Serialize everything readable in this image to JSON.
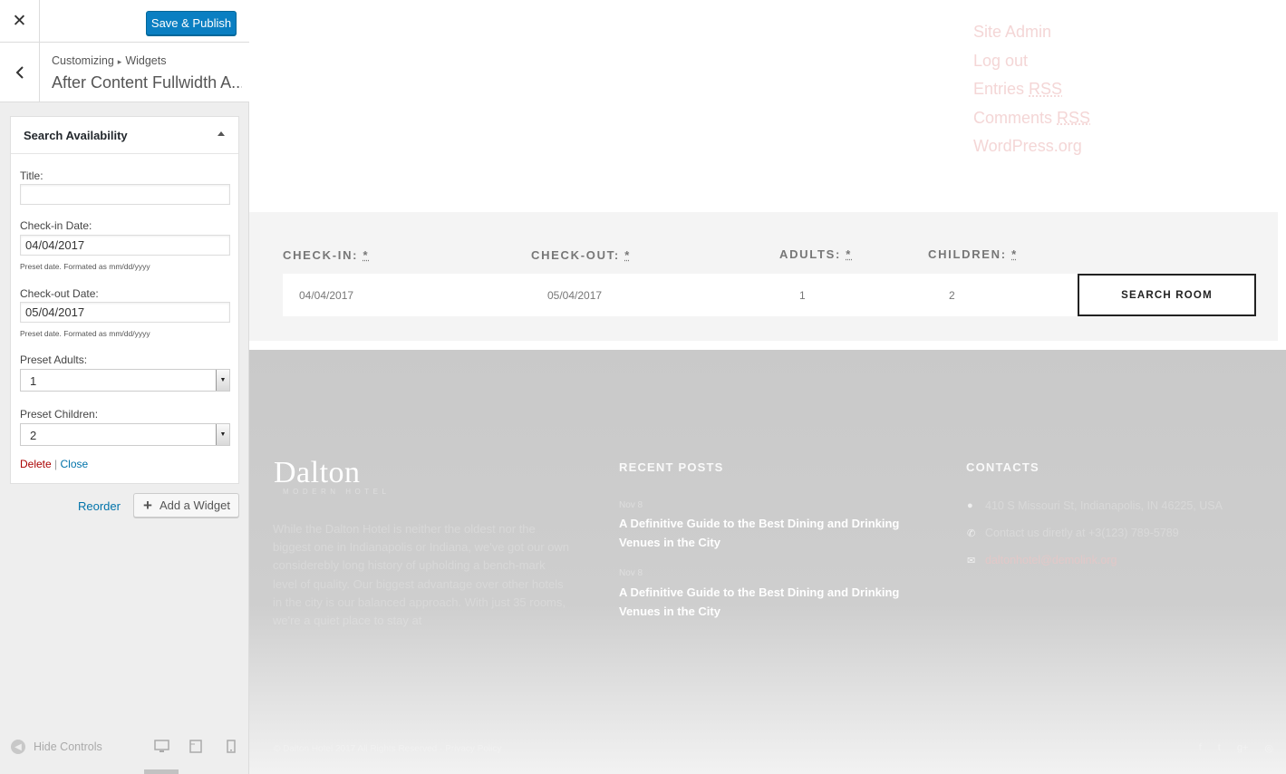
{
  "customizer": {
    "close_glyph": "✕",
    "save_label": "Save & Publish",
    "breadcrumb_root": "Customizing",
    "breadcrumb_sep": "▸",
    "breadcrumb_current": "Widgets",
    "section_title": "After Content Fullwidth A...",
    "widget": {
      "title": "Search Availability",
      "fields": {
        "title_label": "Title:",
        "title_value": "",
        "checkin_label": "Check-in Date:",
        "checkin_value": "04/04/2017",
        "checkin_help": "Preset date. Formated as mm/dd/yyyy",
        "checkout_label": "Check-out Date:",
        "checkout_value": "05/04/2017",
        "checkout_help": "Preset date. Formated as mm/dd/yyyy",
        "adults_label": "Preset Adults:",
        "adults_value": "1",
        "children_label": "Preset Children:",
        "children_value": "2"
      },
      "delete_label": "Delete",
      "separator": "|",
      "close_label": "Close"
    },
    "reorder_label": "Reorder",
    "add_widget_label": "Add a Widget",
    "hide_controls_label": "Hide Controls",
    "accent_color": "#0073aa"
  },
  "preview": {
    "meta_links": {
      "site_admin": "Site Admin",
      "log_out": "Log out",
      "entries_prefix": "Entries ",
      "entries_abbr": "RSS",
      "comments_prefix": "Comments ",
      "comments_abbr": "RSS",
      "wordpress": "WordPress.org"
    },
    "search": {
      "checkin_label": "CHECK-IN:",
      "checkout_label": "CHECK-OUT:",
      "adults_label": "ADULTS:",
      "children_label": "CHILDREN:",
      "required_mark": "*",
      "checkin_value": "04/04/2017",
      "checkout_value": "05/04/2017",
      "adults_value": "1",
      "children_value": "2",
      "button_label": "SEARCH ROOM"
    },
    "footer": {
      "logo_name": "Dalton",
      "logo_tag": "MODERN HOTEL",
      "about": "While the Dalton Hotel is neither the oldest nor the biggest one in Indianapolis or Indiana, we've got our own considerebly long history of upholding a bench-mark level of quality. Our biggest advantage over other hotels in the city is our balanced approach. With just 35 rooms, we're a quiet place to stay at",
      "recent_posts_heading": "RECENT POSTS",
      "posts": [
        {
          "date": "Nov 8",
          "title": "A Definitive Guide to the Best Dining and Drinking Venues in the City"
        },
        {
          "date": "Nov 8",
          "title": "A Definitive Guide to the Best Dining and Drinking Venues in the City"
        }
      ],
      "contacts_heading": "CONTACTS",
      "address": "410 S Missouri St, Indianapolis, IN 46225, USA",
      "phone": "Contact us diretly at +3(123) 789-5789",
      "email": "daltonhotel@demolink.org",
      "copyright": "© Dalton Hotel 2017 All Rights Reserved · Privacy Policy"
    }
  }
}
